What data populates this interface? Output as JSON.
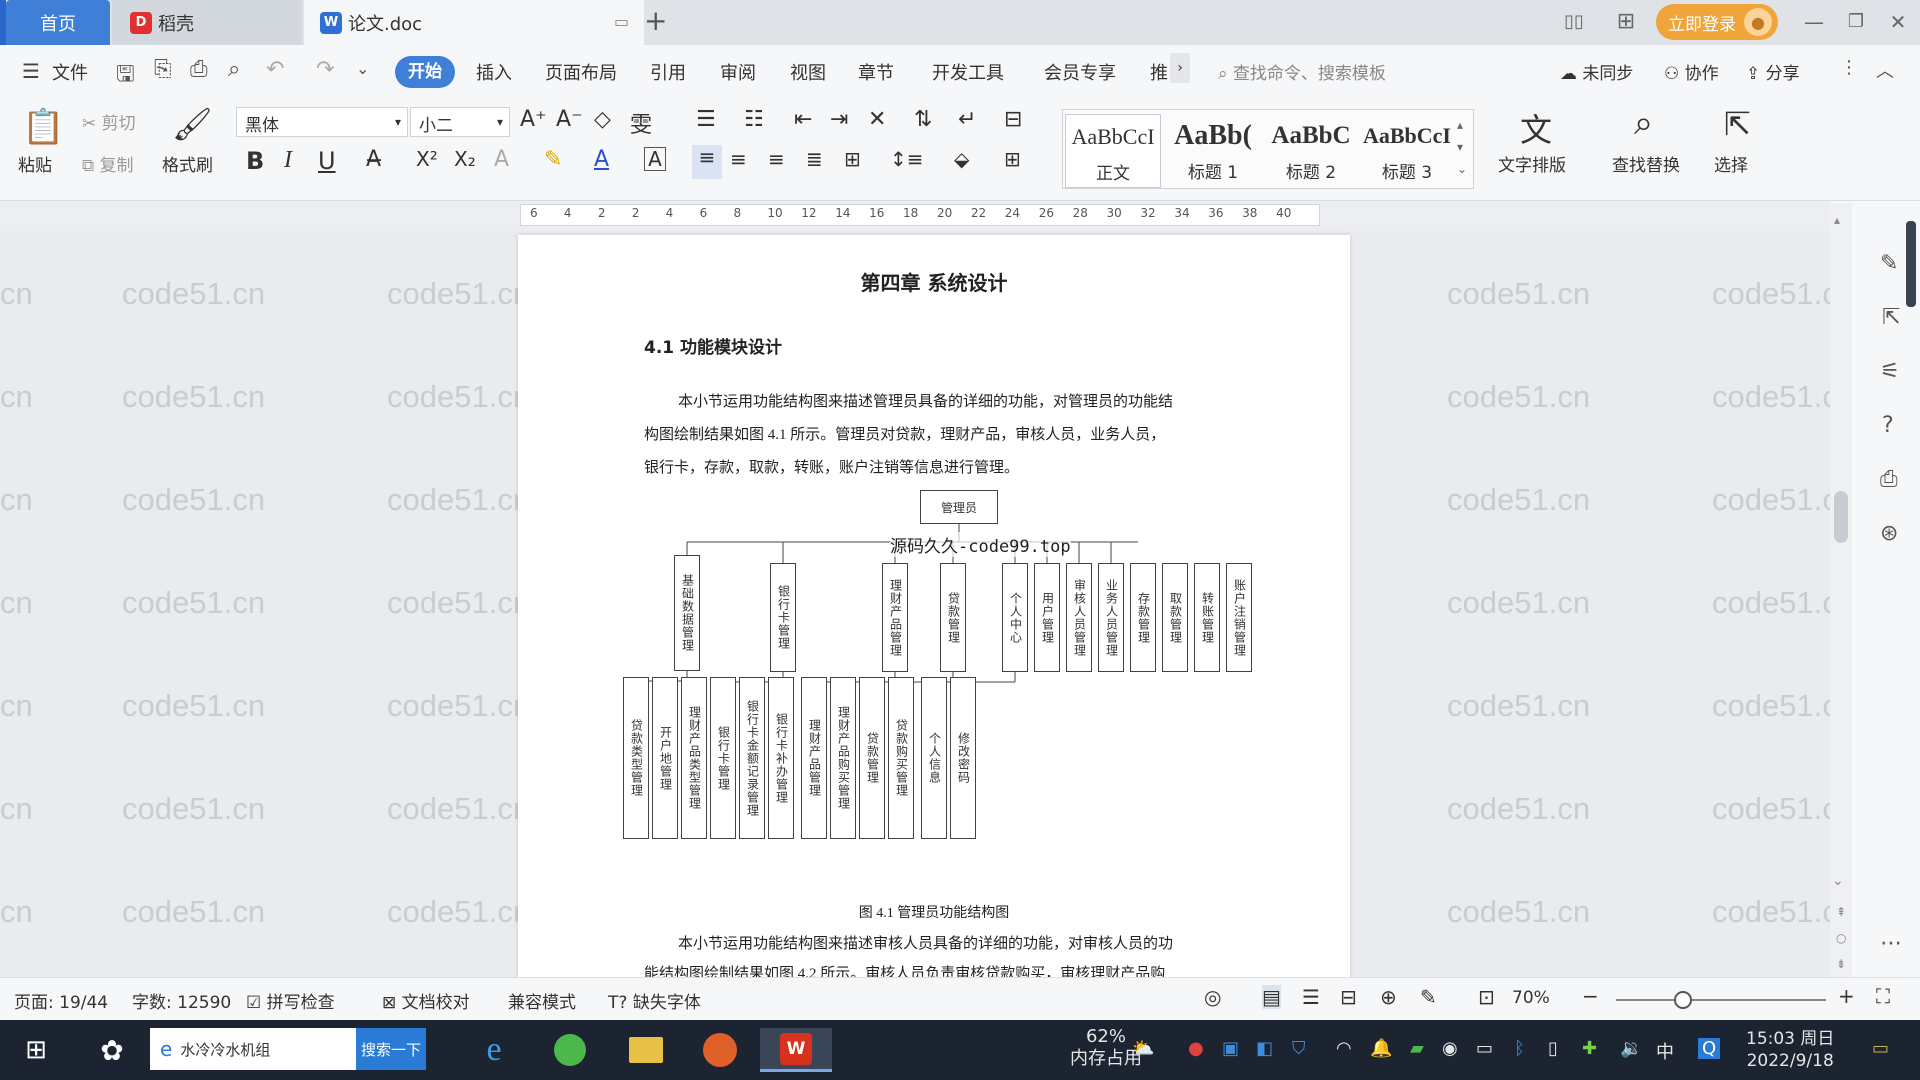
{
  "titlebar": {
    "tabs": [
      {
        "label": "首页"
      },
      {
        "label": "稻壳"
      },
      {
        "label": "论文.doc"
      }
    ],
    "login_label": "立即登录",
    "new_tab": "+"
  },
  "menu": {
    "file": "文件",
    "items": [
      "开始",
      "插入",
      "页面布局",
      "引用",
      "审阅",
      "视图",
      "章节",
      "开发工具",
      "会员专享",
      "推"
    ],
    "search_cmd": "查找命令、搜索模板",
    "unsynced": "未同步",
    "collab": "协作",
    "share": "分享"
  },
  "ribbon": {
    "paste": "粘贴",
    "cut": "剪切",
    "copy": "复制",
    "format_painter": "格式刷",
    "font": "黑体",
    "font_size": "小二",
    "styles": [
      {
        "preview": "AaBbCcI",
        "label": "正文"
      },
      {
        "preview": "AaBb(",
        "label": "标题 1"
      },
      {
        "preview": "AaBbC",
        "label": "标题 2"
      },
      {
        "preview": "AaBbCcI",
        "label": "标题 3"
      }
    ],
    "text_layout": "文字排版",
    "find_replace": "查找替换",
    "select": "选择"
  },
  "ruler": {
    "ticks": [
      "6",
      "4",
      "2",
      "2",
      "4",
      "6",
      "8",
      "10",
      "12",
      "14",
      "16",
      "18",
      "20",
      "22",
      "24",
      "26",
      "28",
      "30",
      "32",
      "34",
      "36",
      "38",
      "40"
    ]
  },
  "watermarks": {
    "text": "code51.cn",
    "edge": "cn",
    "edge_left": "code",
    "overlay": "源码久久-code99.top"
  },
  "document": {
    "chapter_title": "第四章  系统设计",
    "section_title": "4.1 功能模块设计",
    "para1_lines": [
      "本小节运用功能结构图来描述管理员具备的详细的功能，对管理员的功能结",
      "构图绘制结果如图 4.1 所示。管理员对贷款，理财产品，审核人员，业务人员，",
      "银行卡，存款，取款，转账，账户注销等信息进行管理。"
    ],
    "diagram": {
      "root": "管理员",
      "level1": [
        "基础数据管理",
        "银行卡管理",
        "理财产品管理",
        "贷款管理",
        "个人中心",
        "用户管理",
        "审核人员管理",
        "业务人员管理",
        "存款管理",
        "取款管理",
        "转账管理",
        "账户注销管理"
      ],
      "level2": [
        "贷款类型管理",
        "开户地管理",
        "理财产品类型管理",
        "银行卡管理",
        "银行卡金额记录管理",
        "银行卡补办管理",
        "理财产品管理",
        "理财产品购买管理",
        "贷款管理",
        "贷款购买管理",
        "个人信息",
        "修改密码"
      ]
    },
    "caption": "图 4.1 管理员功能结构图",
    "para2_lines": [
      "本小节运用功能结构图来描述审核人员具备的详细的功能，对审核人员的功",
      "能结构图绘制结果如图 4.2 所示。审核人员负责审核贷款购买，审核理财产品购"
    ]
  },
  "statusbar": {
    "page": "页面: 19/44",
    "words": "字数: 12590",
    "spell": "拼写检查",
    "proof": "文档校对",
    "compat": "兼容模式",
    "missing_font": "缺失字体",
    "zoom": "70%"
  },
  "taskbar": {
    "search_text": "水冷冷水机组",
    "search_btn": "搜索一下",
    "mem_percent": "62%",
    "mem_label": "内存占用",
    "ime": "中",
    "time": "15:03 周日",
    "date": "2022/9/18"
  }
}
